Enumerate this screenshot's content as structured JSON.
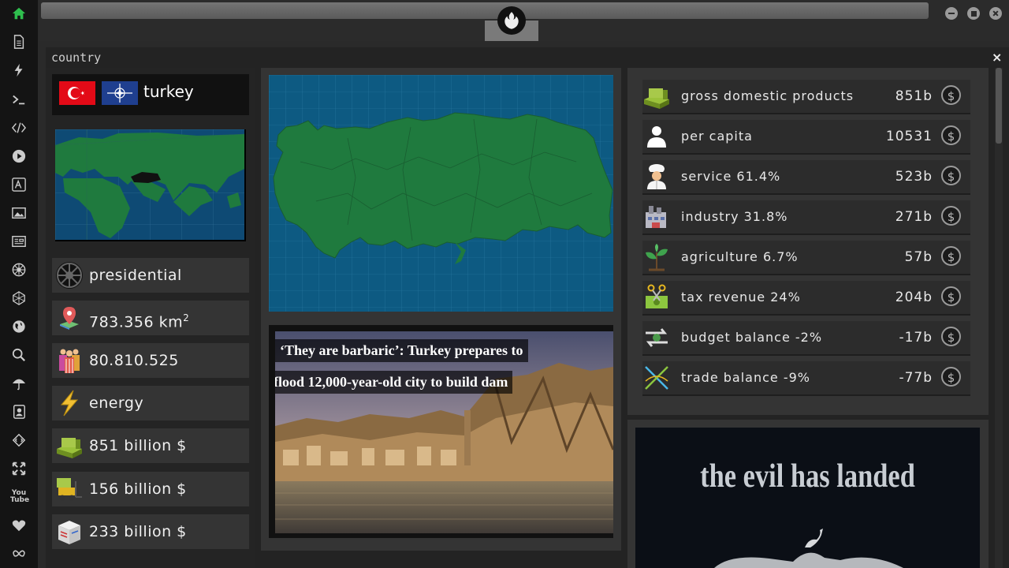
{
  "window": {
    "title": "country",
    "close_label": "×"
  },
  "sidebar": {
    "icons": [
      "home-icon",
      "document-icon",
      "bolt-icon",
      "terminal-icon",
      "code-icon",
      "play-icon",
      "translate-icon",
      "image-icon",
      "news-icon",
      "empire-icon",
      "globe-wire-icon",
      "globe-icon",
      "search-icon",
      "umbrella-icon",
      "contact-icon",
      "diamond-code-icon",
      "expand-icon",
      "youtube-icon",
      "heart-icon",
      "infinity-icon"
    ],
    "youtube_label": "You Tube"
  },
  "country": {
    "name": "turkey",
    "stats": [
      {
        "icon": "empire-emblem-icon",
        "text": "presidential"
      },
      {
        "icon": "map-pin-icon",
        "text": "783.356 km",
        "sup": "2"
      },
      {
        "icon": "population-icon",
        "text": "80.810.525"
      },
      {
        "icon": "energy-bolt-icon",
        "text": "energy"
      },
      {
        "icon": "money-stack-icon",
        "text": "851 billion $"
      },
      {
        "icon": "forklift-icon",
        "text": "156 billion $"
      },
      {
        "icon": "cargo-box-icon",
        "text": "233 billion $"
      }
    ]
  },
  "news": {
    "headline_line1": "‘They are barbaric’: Turkey prepares to",
    "headline_line2": "flood 12,000-year-old city to build dam"
  },
  "economy": [
    {
      "icon": "money-stack-icon",
      "label": "gross domestic products",
      "value": "851b"
    },
    {
      "icon": "person-icon",
      "label": "per capita",
      "value": "10531"
    },
    {
      "icon": "chef-icon",
      "label": "service 61.4%",
      "value": "523b"
    },
    {
      "icon": "factory-icon",
      "label": "industry 31.8%",
      "value": "271b"
    },
    {
      "icon": "plant-icon",
      "label": "agriculture 6.7%",
      "value": "57b"
    },
    {
      "icon": "tax-scissors-icon",
      "label": "tax revenue 24%",
      "value": "204b"
    },
    {
      "icon": "budget-arrows-icon",
      "label": "budget balance -2%",
      "value": "-17b"
    },
    {
      "icon": "trade-cross-icon",
      "label": "trade balance -9%",
      "value": "-77b"
    }
  ],
  "currency_symbol": "$",
  "poster": {
    "title": "the evil has landed"
  },
  "colors": {
    "map_land": "#1f7a3e",
    "map_sea": "#0d5a82",
    "accent_home": "#2fbf4e"
  }
}
